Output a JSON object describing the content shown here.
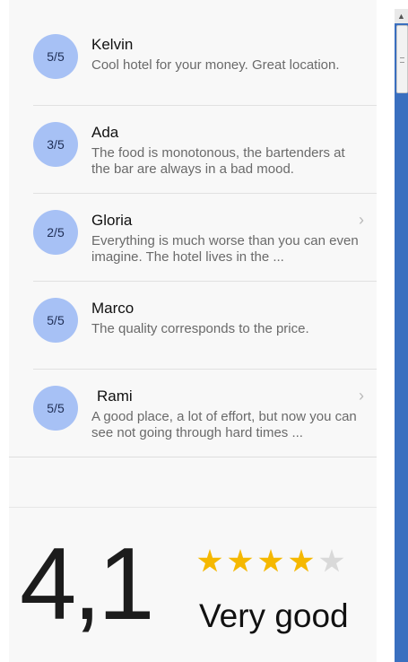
{
  "reviews": [
    {
      "rating": "5/5",
      "name": "Kelvin",
      "text": "Cool hotel for your money. Great location.",
      "has_chevron": false
    },
    {
      "rating": "3/5",
      "name": "Ada",
      "text": "The food is monotonous, the bartenders at the bar are always in a bad mood.",
      "has_chevron": false
    },
    {
      "rating": "2/5",
      "name": "Gloria",
      "text": "Everything is much worse than you can even imagine. The hotel lives in the ...",
      "has_chevron": true
    },
    {
      "rating": "5/5",
      "name": "Marco",
      "text": "The quality corresponds to the price.",
      "has_chevron": false
    },
    {
      "rating": "5/5",
      "name": "Rami",
      "text": "A good place, a lot of effort, but now you can see not going through hard times ...",
      "has_chevron": true
    }
  ],
  "summary": {
    "score": "4,1",
    "stars_filled": 4,
    "stars_total": 5,
    "label": "Very good"
  },
  "icons": {
    "chevron": "chevron-right-icon",
    "star": "star-icon",
    "scroll_up": "arrow-up-icon"
  },
  "colors": {
    "badge": "#a7c1f5",
    "star_on": "#f5b800",
    "star_off": "#d9d9d9",
    "scrollbar": "#3a6fbf"
  }
}
